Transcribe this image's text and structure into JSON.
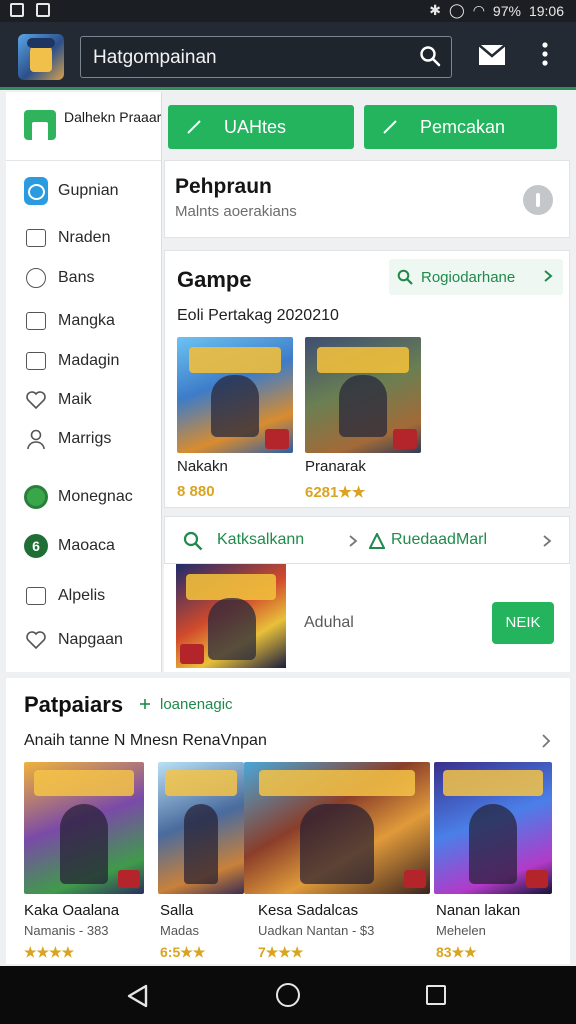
{
  "status_bar": {
    "battery": "97%",
    "time": "19:06"
  },
  "app_bar": {
    "search_text": "Hatgompainan"
  },
  "sidebar": {
    "brand": "Dalhekn Praaar",
    "items": [
      {
        "label": "Gupnian",
        "icon": "chat-icon"
      },
      {
        "label": "Nraden",
        "icon": "folder-icon"
      },
      {
        "label": "Bans",
        "icon": "clock-icon"
      },
      {
        "label": "Mangka",
        "icon": "bookmark-icon"
      },
      {
        "label": "Madagin",
        "icon": "calendar-icon"
      },
      {
        "label": "Maik",
        "icon": "heart-icon"
      },
      {
        "label": "Marrigs",
        "icon": "person-icon"
      },
      {
        "label": "Monegnac",
        "icon": "globe-icon"
      },
      {
        "label": "Maoaca",
        "icon": "six-icon"
      },
      {
        "label": "Alpelis",
        "icon": "tag-icon"
      },
      {
        "label": "Napgaan",
        "icon": "heart-outline-icon"
      }
    ]
  },
  "top_buttons": {
    "updates": "UAHtes",
    "purchased": "Pemcakan"
  },
  "profile": {
    "title": "Pehpraun",
    "subtitle": "Malnts aoerakians"
  },
  "games": {
    "title": "Gampe",
    "recommend": "Rogiodarhane",
    "subtitle": "Eoli Pertakag 2020210",
    "items": [
      {
        "name": "Nakakn",
        "rating": "8 880"
      },
      {
        "name": "Pranarak",
        "rating": "6281★★"
      }
    ]
  },
  "actions": {
    "search": "Katksalkann",
    "redeem": "RuedaadMarl"
  },
  "feature": {
    "text": "Aduhal",
    "button": "NEIK"
  },
  "popular": {
    "title": "Patpaiars",
    "tag": "loanenagic",
    "subtitle": "Anaih tanne N Mnesn RenaVnpan",
    "items": [
      {
        "name": "Kaka Oaalana",
        "meta": "Namanis  -  383",
        "rating": "★★★★"
      },
      {
        "name": "Salla",
        "meta": "Madas",
        "rating": "6:5★★"
      },
      {
        "name": "Kesa Sadalcas",
        "meta": "Uadkan Nantan  -  $3",
        "rating": "7★★★"
      },
      {
        "name": "Nanan lakan",
        "meta": "Mehelen",
        "rating": "83★★"
      }
    ]
  },
  "colors": {
    "accent": "#23b45d",
    "appbar": "#232a33",
    "link": "#1f8a4c",
    "rating": "#d9a421"
  }
}
